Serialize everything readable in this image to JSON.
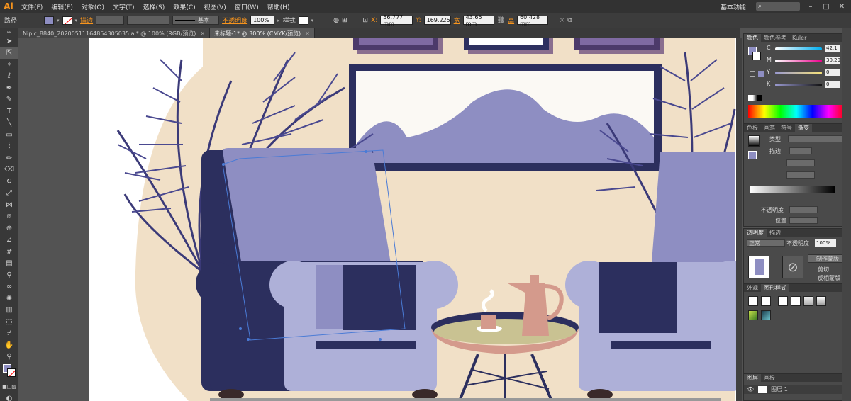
{
  "app": {
    "logo": "Ai",
    "workspace": "基本功能"
  },
  "menu": [
    "文件(F)",
    "编辑(E)",
    "对象(O)",
    "文字(T)",
    "选择(S)",
    "效果(C)",
    "视图(V)",
    "窗口(W)",
    "帮助(H)"
  ],
  "control": {
    "path_label": "路径",
    "stroke_label": "描边",
    "stroke_style": "基本",
    "opacity_label": "不透明度",
    "opacity_value": "100%",
    "style_label": "样式",
    "x_value": "56.777 mm",
    "y_value": "169.225",
    "w_label": "宽",
    "w_value": "43.65 mm",
    "h_label": "高",
    "h_value": "60.428 mm"
  },
  "tabs": [
    {
      "label": "Nipic_8840_20200511164854305035.ai* @ 100% (RGB/预览)"
    },
    {
      "label": "未标题-1* @ 300% (CMYK/预览)"
    }
  ],
  "color_panel": {
    "tabs": [
      "颜色",
      "颜色参考",
      "Kuler"
    ],
    "channels": [
      {
        "name": "C",
        "value": "42.1"
      },
      {
        "name": "M",
        "value": "30.29"
      },
      {
        "name": "Y",
        "value": "0"
      },
      {
        "name": "K",
        "value": "0"
      }
    ],
    "fill_color": "#8e8ec2"
  },
  "gradient_panel": {
    "tabs": [
      "色板",
      "画笔",
      "符号",
      "渐变"
    ],
    "type_label": "类型",
    "stroke_label": "描边",
    "opacity_label": "不透明度",
    "position_label": "位置"
  },
  "transparency_panel": {
    "tabs": [
      "透明度",
      "描边"
    ],
    "mode": "正常",
    "opacity_label": "不透明度",
    "opacity_value": "100%",
    "make_mask": "制作蒙版",
    "clip": "剪切",
    "invert_mask": "反相蒙版"
  },
  "appearance_panel": {
    "tabs": [
      "外观",
      "图形样式"
    ]
  },
  "layers_panel": {
    "tabs": [
      "图层",
      "画板"
    ],
    "layer_name": "图层 1"
  }
}
